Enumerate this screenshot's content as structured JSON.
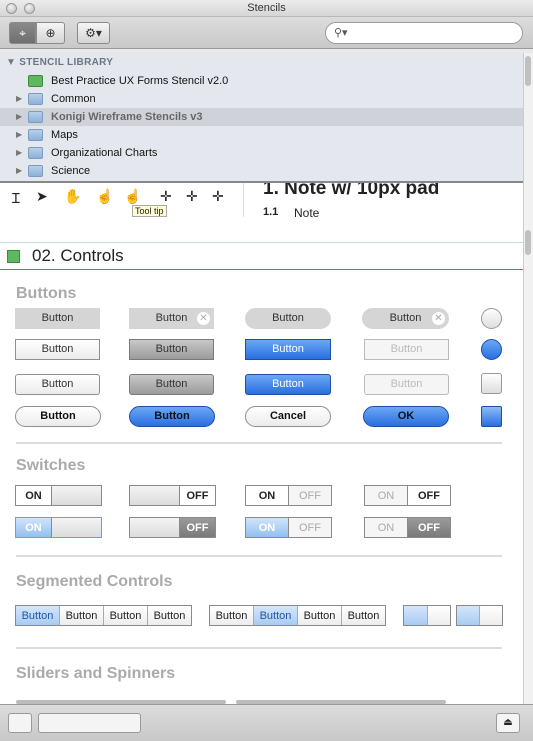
{
  "window": {
    "title": "Stencils"
  },
  "toolbar": {
    "search_placeholder": "",
    "search_icon": "magnifier-icon",
    "gear_icon": "gear-icon"
  },
  "library": {
    "header": "STENCIL LIBRARY",
    "items": [
      {
        "label": "Best Practice UX Forms Stencil v2.0",
        "type": "stencil"
      },
      {
        "label": "Common",
        "type": "folder"
      },
      {
        "label": "Konigi Wireframe Stencils v3",
        "type": "folder",
        "selected": true
      },
      {
        "label": "Maps",
        "type": "folder"
      },
      {
        "label": "Organizational Charts",
        "type": "folder"
      },
      {
        "label": "Science",
        "type": "folder"
      }
    ]
  },
  "preview": {
    "tooltip": "Tool tip",
    "note_heading": "1.  Note w/ 10px pad",
    "note_number": "1.1",
    "note_text": "Note"
  },
  "section": {
    "title": "02. Controls"
  },
  "groups": {
    "buttons": "Buttons",
    "switches": "Switches",
    "segmented": "Segmented Controls",
    "sliders": "Sliders and Spinners"
  },
  "buttons": {
    "label": "Button",
    "cancel": "Cancel",
    "ok": "OK"
  },
  "switches": {
    "on": "ON",
    "off": "OFF"
  },
  "segmented": {
    "label": "Button"
  }
}
